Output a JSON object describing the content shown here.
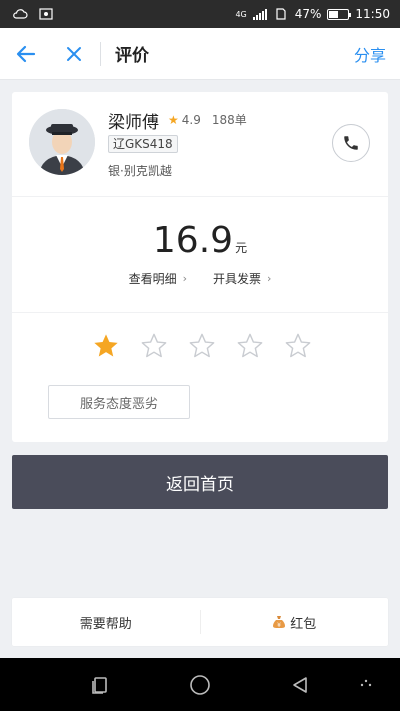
{
  "status_bar": {
    "network": "4G",
    "signal_label": "4G",
    "battery_percent": "47%",
    "battery_level": 0.47,
    "time": "11:50"
  },
  "nav": {
    "title": "评价",
    "share_label": "分享"
  },
  "driver": {
    "name": "梁师傅",
    "rating": "4.9",
    "orders": "188单",
    "plate": "辽GKS418",
    "car_model": "银·别克凯越"
  },
  "trip": {
    "price": "16.9",
    "unit": "元",
    "details_link": "查看明细",
    "invoice_link": "开具发票"
  },
  "review": {
    "selected_stars": 1,
    "total_stars": 5,
    "tag": "服务态度恶劣"
  },
  "actions": {
    "home_button": "返回首页",
    "help": "需要帮助",
    "red_packet": "红包"
  },
  "colors": {
    "accent": "#2a8ff0",
    "star_active": "#f5a623",
    "button_bg": "#4a4c5a"
  }
}
